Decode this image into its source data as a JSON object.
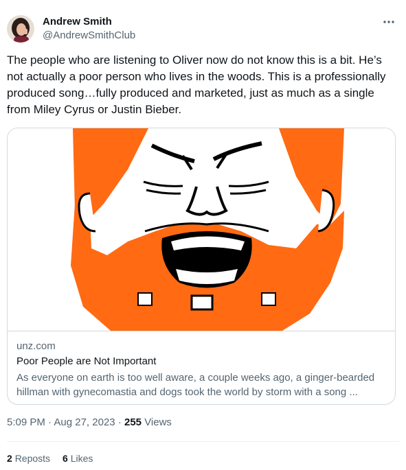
{
  "author": {
    "name": "Andrew Smith",
    "handle": "@AndrewSmithClub"
  },
  "more_icon": "more-horizontal-icon",
  "tweet": {
    "text": "The people who are listening to Oliver now do not know this is a bit. He’s not actually a poor person who lives in the woods. This is a professionally produced song…fully produced and marketed, just as much as a single from Miley Cyrus or Justin Bieber."
  },
  "card": {
    "domain": "unz.com",
    "title": "Poor People are Not Important",
    "description": "As everyone on earth is too well aware, a couple weeks ago, a ginger-bearded hillman with gynecomastia and dogs took the world by storm with a song ..."
  },
  "meta": {
    "time": "5:09 PM",
    "date": "Aug 27, 2023",
    "views_count": "255",
    "views_label": "Views"
  },
  "stats": {
    "reposts_count": "2",
    "reposts_label": "Reposts",
    "likes_count": "6",
    "likes_label": "Likes"
  },
  "colors": {
    "beard": "#ff6a13",
    "text_primary": "#0f1419",
    "text_secondary": "#536471",
    "border": "#cfd9de"
  }
}
